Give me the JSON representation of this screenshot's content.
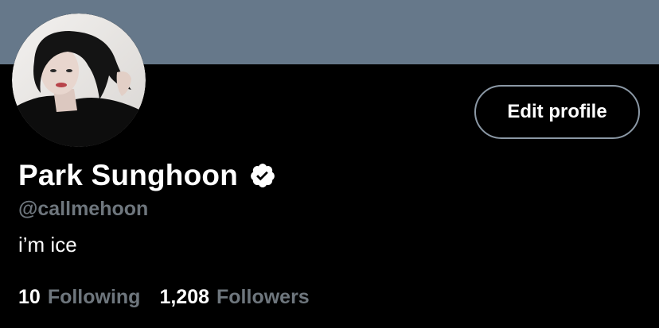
{
  "profile": {
    "display_name": "Park Sunghoon",
    "handle": "@callmehoon",
    "bio": "i’m ice",
    "verified": true,
    "edit_button_label": "Edit profile"
  },
  "stats": {
    "following_count": "10",
    "following_label": "Following",
    "followers_count": "1,208",
    "followers_label": "Followers"
  },
  "icons": {
    "verified": "verified-badge-icon",
    "avatar": "profile-avatar"
  },
  "colors": {
    "banner": "#66788a",
    "background": "#000000",
    "text_primary": "#ffffff",
    "text_secondary": "#6e767d",
    "button_border": "#8b98a5"
  }
}
